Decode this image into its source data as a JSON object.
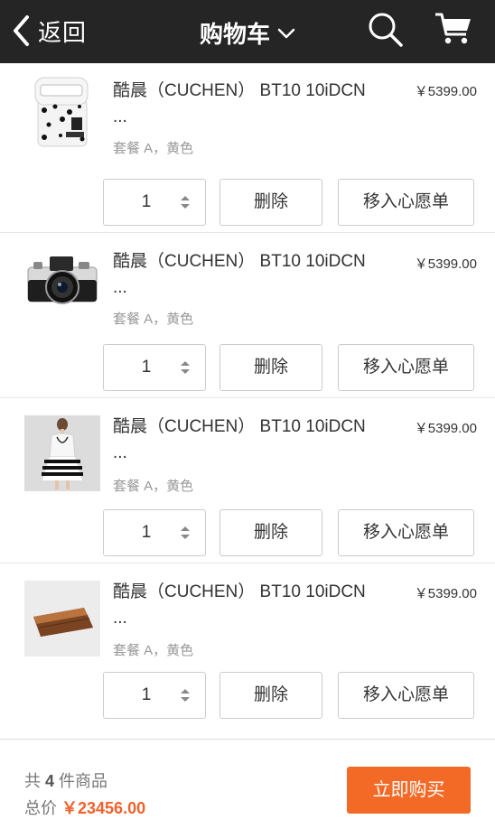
{
  "header": {
    "back_label": "返回",
    "title": "购物车",
    "icons": {
      "back": "chevron-left-icon",
      "dropdown": "chevron-down-icon",
      "search": "search-icon",
      "cart": "cart-icon"
    }
  },
  "items": [
    {
      "name": "酷晨（CUCHEN） BT10 10iDCN ...",
      "price": "￥5399.00",
      "spec": "套餐 A，黄色",
      "quantity": "1",
      "delete_label": "删除",
      "wishlist_label": "移入心愿单",
      "image": "speaker-product-image"
    },
    {
      "name": "酷晨（CUCHEN） BT10 10iDCN ...",
      "price": "￥5399.00",
      "spec": "套餐 A，黄色",
      "quantity": "1",
      "delete_label": "删除",
      "wishlist_label": "移入心愿单",
      "image": "camera-product-image"
    },
    {
      "name": "酷晨（CUCHEN） BT10 10iDCN ...",
      "price": "￥5399.00",
      "spec": "套餐 A，黄色",
      "quantity": "1",
      "delete_label": "删除",
      "wishlist_label": "移入心愿单",
      "image": "dress-product-image"
    },
    {
      "name": "酷晨（CUCHEN） BT10 10iDCN ...",
      "price": "￥5399.00",
      "spec": "套餐 A，黄色",
      "quantity": "1",
      "delete_label": "删除",
      "wishlist_label": "移入心愿单",
      "image": "wallet-product-image"
    }
  ],
  "footer": {
    "count_prefix": "共",
    "count": "4",
    "count_suffix": "件商品",
    "total_label": "总价",
    "total_amount": "￥23456.00",
    "buy_label": "立即购买"
  },
  "colors": {
    "header_bg": "#252525",
    "accent": "#f36a26",
    "price_total": "#f0612b"
  }
}
